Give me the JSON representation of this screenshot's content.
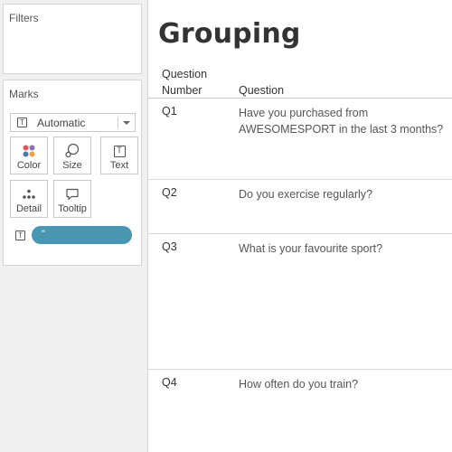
{
  "panels": {
    "filters": {
      "title": "Filters"
    },
    "marks": {
      "title": "Marks",
      "mark_type": "Automatic",
      "buttons": {
        "color": "Color",
        "size": "Size",
        "text": "Text",
        "detail": "Detail",
        "tooltip": "Tooltip"
      },
      "text_pill_label": "\""
    }
  },
  "sheet": {
    "title": "Grouping",
    "columns": {
      "number_line1": "Question",
      "number_line2": "Number",
      "question": "Question"
    },
    "rows": [
      {
        "number": "Q1",
        "question_line1": "Have you purchased from",
        "question_line2": "AWESOMESPORT in the last 3 months?"
      },
      {
        "number": "Q2",
        "question_line1": "Do you exercise regularly?"
      },
      {
        "number": "Q3",
        "question_line1": "What is your favourite sport?"
      },
      {
        "number": "Q4",
        "question_line1": "How often do you train?"
      }
    ]
  },
  "colors": {
    "pill": "#4996b2",
    "background": "#f0f0f0",
    "color_dots": [
      "#e15759",
      "#8b6fae",
      "#4e79a7",
      "#f1a340"
    ]
  }
}
